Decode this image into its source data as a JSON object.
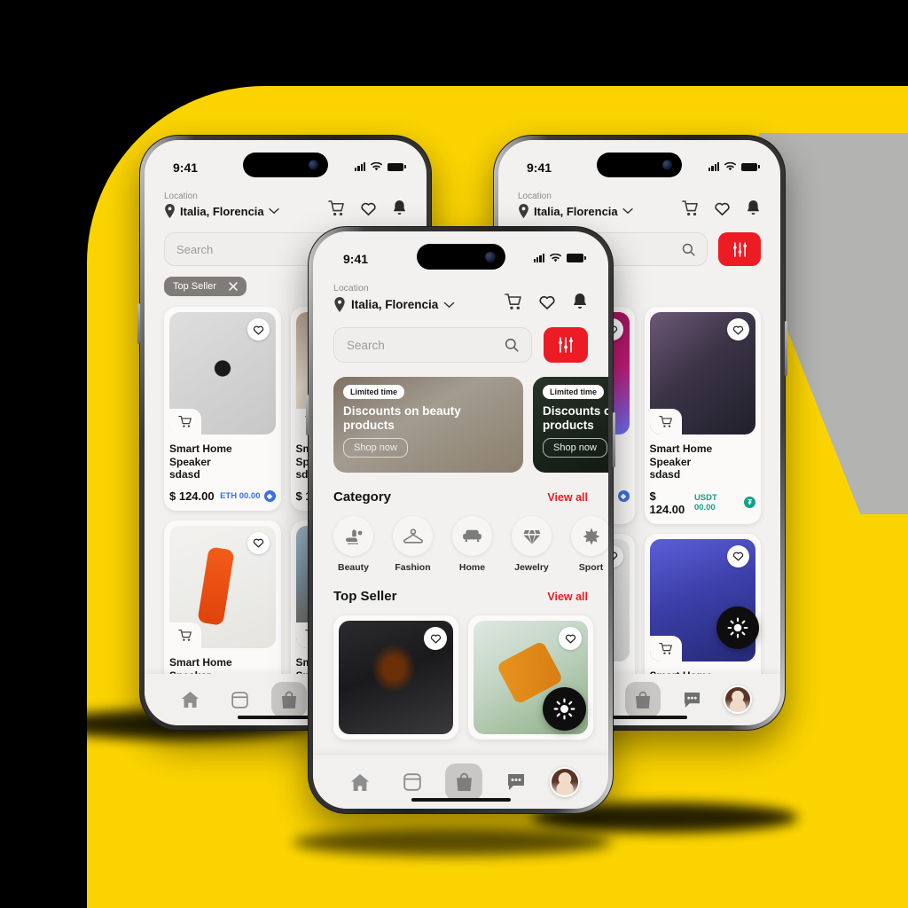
{
  "canvas": {
    "bg_color": "#000000",
    "blob_color": "#FBD400",
    "accent_red": "#ED1B24"
  },
  "status_bar": {
    "time": "9:41",
    "signal_icon": "cellular-bars-icon",
    "wifi_icon": "wifi-icon",
    "battery_icon": "battery-icon"
  },
  "app_header": {
    "location_label": "Location",
    "location_value": "Italia, Florencia",
    "chevron_icon": "chevron-down-icon",
    "pin_icon": "map-pin-icon",
    "icons": [
      "cart-icon",
      "heart-icon",
      "bell-icon"
    ]
  },
  "search": {
    "placeholder": "Search",
    "search_icon": "search-icon",
    "filter_icon": "sliders-icon"
  },
  "filter_chip": {
    "label": "Top Seller",
    "close_icon": "close-icon"
  },
  "banners": [
    {
      "tag": "Limited time",
      "title": "Discounts on beauty products",
      "cta": "Shop now",
      "image": "beauty-serum-photo"
    },
    {
      "tag": "Limited time",
      "title": "Discounts on beauty products",
      "cta": "Shop now",
      "image": "plant-dark-photo"
    }
  ],
  "sections": {
    "category": {
      "title": "Category",
      "view_all": "View all"
    },
    "top_seller": {
      "title": "Top Seller",
      "view_all": "View all"
    }
  },
  "categories": [
    {
      "label": "Beauty",
      "icon": "hand-soap-icon"
    },
    {
      "label": "Fashion",
      "icon": "hanger-icon"
    },
    {
      "label": "Home",
      "icon": "sofa-icon"
    },
    {
      "label": "Jewelry",
      "icon": "diamond-icon"
    },
    {
      "label": "Sport",
      "icon": "sport-icon"
    }
  ],
  "product": {
    "name_line1": "Smart Home Speaker",
    "name_line2": "sdasd",
    "price": "$ 124.00",
    "heart_icon": "heart-outline-icon",
    "cart_icon": "cart-add-icon"
  },
  "crypto": {
    "eth": {
      "label": "ETH 00.00",
      "symbol": "♦",
      "color": "#3c6fe0"
    },
    "usdt": {
      "label": "USDT 00.00",
      "symbol": "₮",
      "color": "#16a085"
    }
  },
  "left_phone_products": [
    {
      "image": "smart-watch-white-photo",
      "crypto": "eth"
    },
    {
      "image": "stone-texture-photo",
      "crypto": "eth"
    },
    {
      "image": "orange-cosmetics-photo",
      "crypto": "eth"
    },
    {
      "image": "mountain-photo",
      "crypto": "eth"
    }
  ],
  "right_phone_products": [
    {
      "image": "magenta-gradient-photo",
      "crypto": "eth"
    },
    {
      "image": "steam-deck-photo",
      "crypto": "usdt"
    },
    {
      "image": "headphones-photo",
      "crypto": "usdt"
    },
    {
      "image": "sony-controller-photo",
      "crypto": "usdt"
    }
  ],
  "center_top_seller": [
    {
      "image": "apple-watch-black-photo"
    },
    {
      "image": "juice-bottles-photo"
    }
  ],
  "fab": {
    "icon": "brightness-sun-icon"
  },
  "tabbar": {
    "items": [
      {
        "name": "home",
        "icon": "home-icon",
        "active": false
      },
      {
        "name": "orders",
        "icon": "box-icon",
        "active": false
      },
      {
        "name": "shop",
        "icon": "shopping-bag-icon",
        "active": true
      },
      {
        "name": "messages",
        "icon": "chat-bubble-icon",
        "active": false
      },
      {
        "name": "profile",
        "icon": "avatar-photo",
        "active": false
      }
    ]
  }
}
